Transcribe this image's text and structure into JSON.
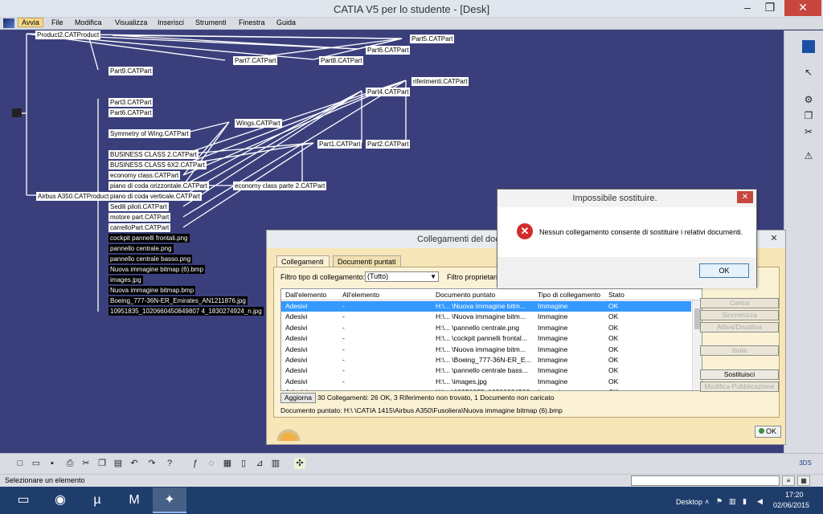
{
  "window": {
    "title": "CATIA V5 per lo studente - [Desk]",
    "min": "–",
    "max": "❐",
    "close": "✕"
  },
  "menu": [
    "Avvia",
    "File",
    "Modifica",
    "Visualizza",
    "Inserisci",
    "Strumenti",
    "Finestra",
    "Guida"
  ],
  "tree": {
    "nodes": [
      {
        "label": "Product2.CATProduct",
        "dark": false
      },
      {
        "label": "Part5.CATPart",
        "dark": false
      },
      {
        "label": "Part6.CATPart",
        "dark": false
      },
      {
        "label": "Part7.CATPart",
        "dark": false
      },
      {
        "label": "Part8.CATPart",
        "dark": false
      },
      {
        "label": "Part9.CATPart",
        "dark": false
      },
      {
        "label": "riferimenti.CATPart",
        "dark": false
      },
      {
        "label": "Part4.CATPart",
        "dark": false
      },
      {
        "label": "Part3.CATPart",
        "dark": false
      },
      {
        "label": "Part6.CATPart",
        "dark": false
      },
      {
        "label": "Symmetry of Wing.CATPart",
        "dark": false
      },
      {
        "label": "Wings.CATPart",
        "dark": false
      },
      {
        "label": "Part1.CATPart",
        "dark": false
      },
      {
        "label": "Part2.CATPart",
        "dark": false
      },
      {
        "label": "BUSINESS CLASS 2.CATPart",
        "dark": false
      },
      {
        "label": "BUSINESS CLASS 6X2.CATPart",
        "dark": false
      },
      {
        "label": "economy class.CATPart",
        "dark": false
      },
      {
        "label": "piano di coda orizzontale.CATPart",
        "dark": false
      },
      {
        "label": "economy class parte 2.CATPart",
        "dark": false
      },
      {
        "label": "Airbus A350.CATProduct",
        "dark": false
      },
      {
        "label": "piano di coda verticale.CATPart",
        "dark": false
      },
      {
        "label": "Sedili piloti.CATPart",
        "dark": false
      },
      {
        "label": "motore part.CATPart",
        "dark": false
      },
      {
        "label": "carrelloPart.CATPart",
        "dark": false
      },
      {
        "label": "cockpit pannelli frontali.png",
        "dark": true
      },
      {
        "label": "pannello centrale.png",
        "dark": true
      },
      {
        "label": "pannello centrale basso.png",
        "dark": true
      },
      {
        "label": "Nuova immagine bitmap (6).bmp",
        "dark": true
      },
      {
        "label": "images.jpg",
        "dark": true
      },
      {
        "label": "Nuova immagine bitmap.bmp",
        "dark": true
      },
      {
        "label": "Boeing_777-36N-ER_Emirates_AN1211876.jpg",
        "dark": true
      },
      {
        "label": "10951835_1020660450849807 4_1830274924_n.jpg",
        "dark": true
      }
    ]
  },
  "links_dialog": {
    "title": "Collegamenti del documento",
    "tabs": [
      "Collegamenti",
      "Documenti puntati"
    ],
    "filter_type_label": "Filtro tipo di collegamento:",
    "filter_type_value": "(Tutto)",
    "filter_owner_label": "Filtro proprietario",
    "columns": [
      "Dall'elemento",
      "All'elemento",
      "Documento puntato",
      "Tipo di collegamento",
      "Stato"
    ],
    "rows": [
      [
        "Adesivi",
        "-",
        "H:\\... \\Nuova immagine bitm...",
        "Immagine",
        "OK"
      ],
      [
        "Adesivi",
        "-",
        "H:\\... \\Nuova immagine bitm...",
        "Immagine",
        "OK"
      ],
      [
        "Adesivi",
        "-",
        "H:\\... \\pannello centrale.png",
        "Immagine",
        "OK"
      ],
      [
        "Adesivi",
        "-",
        "H:\\... \\cockpit pannelli frontal...",
        "Immagine",
        "OK"
      ],
      [
        "Adesivi",
        "-",
        "H:\\... \\Nuova immagine bitm...",
        "Immagine",
        "OK"
      ],
      [
        "Adesivi",
        "-",
        "H:\\... \\Boeing_777-36N-ER_E...",
        "Immagine",
        "OK"
      ],
      [
        "Adesivi",
        "-",
        "H:\\... \\pannello centrale bass...",
        "Immagine",
        "OK"
      ],
      [
        "Adesivi",
        "-",
        "H:\\... \\images.jpg",
        "Immagine",
        "OK"
      ],
      [
        "Adesivi",
        "-",
        "H:\\... \\10951835_10206604508...",
        "Immagine",
        "OK"
      ]
    ],
    "side_buttons": [
      {
        "label": "Carica",
        "enabled": false
      },
      {
        "label": "Sincronizza",
        "enabled": false
      },
      {
        "label": "Attiva/Disattiva",
        "enabled": false
      },
      {
        "label": "Isola",
        "enabled": false
      },
      {
        "label": "Sostituisci",
        "enabled": true
      },
      {
        "label": "Modifica Pubblicazione",
        "enabled": false
      }
    ],
    "refresh_label": "Aggiorna",
    "summary": "30 Collegamenti: 26 OK, 3 Riferimento non trovato, 1 Documento non caricato",
    "pointed_doc": "Documento puntato: H:\\ \\CATIA 1415\\Airbus A350\\Fusoliera\\Nuova immagine bitmap (6).bmp",
    "ok_label": "OK"
  },
  "error_dialog": {
    "title": "Impossibile sostituire.",
    "message": "Nessun collegamento consente di sostituire i relativi documenti.",
    "ok_label": "OK",
    "close": "✕"
  },
  "status": {
    "message": "Selezionare un elemento"
  },
  "taskbar": {
    "desktop_label": "Desktop",
    "time": "17:20",
    "date": "02/06/2015"
  },
  "colors": {
    "background": "#3a3f7c",
    "selection": "#3399ff",
    "dialog": "#f7e7b8",
    "error_icon": "#d32b2b"
  }
}
